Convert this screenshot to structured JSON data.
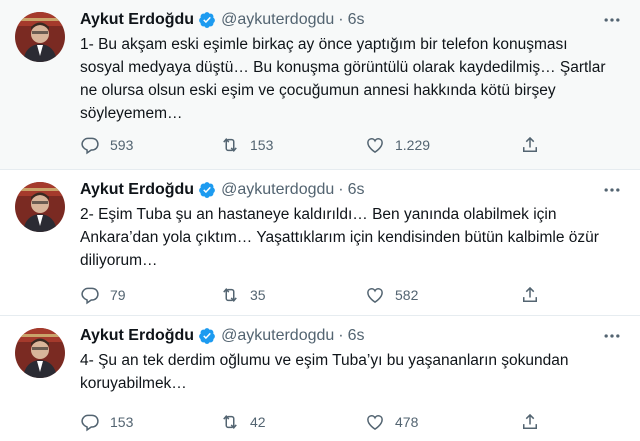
{
  "tweets": [
    {
      "name": "Aykut Erdoğdu",
      "handle": "@aykuterdogdu",
      "separator": "·",
      "time": "6s",
      "text": "1- Bu akşam eski eşimle birkaç ay önce yaptığım bir telefon konuşması\nsosyal medyaya düştü… Bu konuşma görüntülü olarak kaydedilmiş… Şartlar\nne olursa olsun eski eşim ve çocuğumun annesi hakkında kötü birşey\nsöyleyemem…",
      "replies": "593",
      "retweets": "153",
      "likes": "1.229"
    },
    {
      "name": "Aykut Erdoğdu",
      "handle": "@aykuterdogdu",
      "separator": "·",
      "time": "6s",
      "text": "2- Eşim Tuba şu an hastaneye kaldırıldı… Ben yanında olabilmek için\nAnkara’dan yola çıktım… Yaşattıklarım için kendisinden bütün kalbimle özür\ndiliyorum…",
      "replies": "79",
      "retweets": "35",
      "likes": "582"
    },
    {
      "name": "Aykut Erdoğdu",
      "handle": "@aykuterdogdu",
      "separator": "·",
      "time": "6s",
      "text": "4- Şu an tek derdim oğlumu ve eşim Tuba’yı bu yaşananların şokundan\nkoruyabilmek…",
      "replies": "153",
      "retweets": "42",
      "likes": "478"
    }
  ],
  "colors": {
    "verified": "#1d9bf0",
    "secondary_text": "#536471",
    "primary_text": "#0f1419",
    "highlight_bg": "#f7f9f9"
  },
  "icons": [
    "verified-badge-icon",
    "more-caret-icon",
    "reply-icon",
    "retweet-icon",
    "like-icon",
    "share-icon"
  ]
}
